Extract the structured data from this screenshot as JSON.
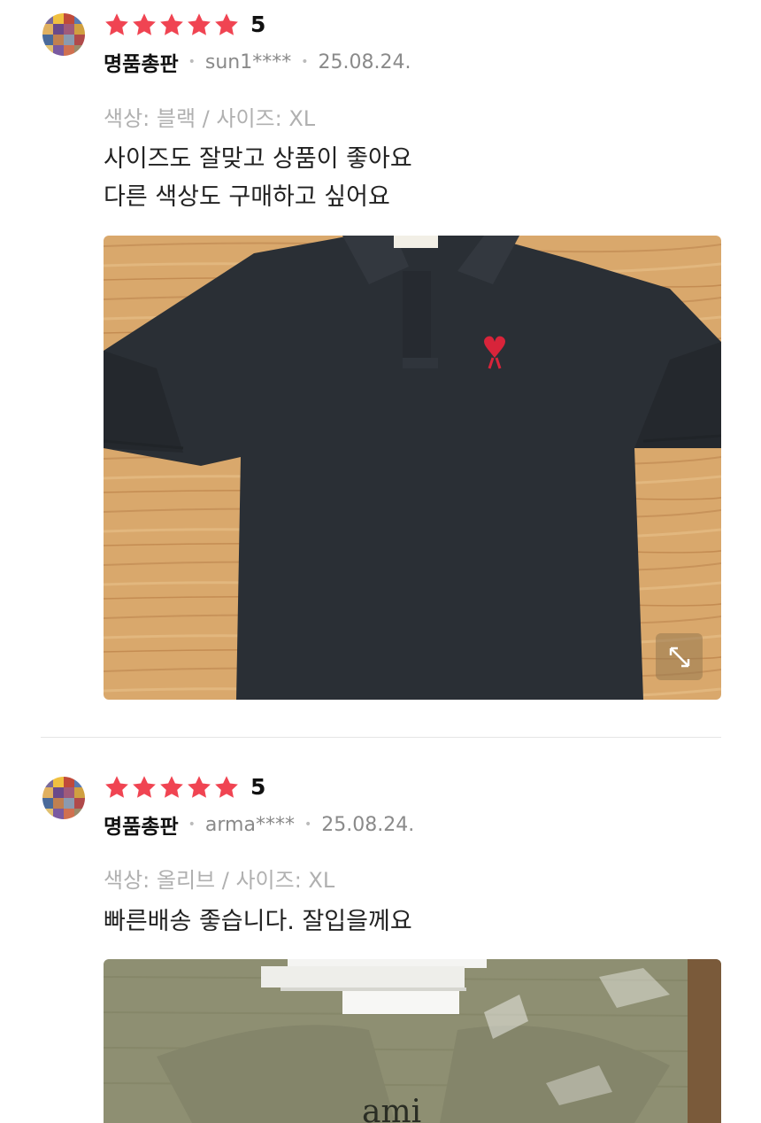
{
  "reviews": [
    {
      "rating": "5",
      "store": "명품총판",
      "user": "sun1****",
      "date": "25.08.24.",
      "option": "색상: 블랙 / 사이즈: XL",
      "text_lines": [
        "사이즈도  잘맞고 상품이 좋아요",
        "다른  색상도 구매하고 싶어요"
      ],
      "photo_icon": "black-polo-shirt-image"
    },
    {
      "rating": "5",
      "store": "명품총판",
      "user": "arma****",
      "date": "25.08.24.",
      "option": "색상: 올리브 / 사이즈: XL",
      "text_lines": [
        "빠른배송 좋습니다. 잘입을께요"
      ],
      "photo_icon": "olive-polo-shirt-image"
    }
  ],
  "colors": {
    "star": "#f04452",
    "meta_gray": "#8a8a8a",
    "option_gray": "#b0b0b0",
    "shirt_black": "#2a2f35",
    "shirt_olive": "#8e8f72",
    "logo_red": "#d8243a"
  }
}
